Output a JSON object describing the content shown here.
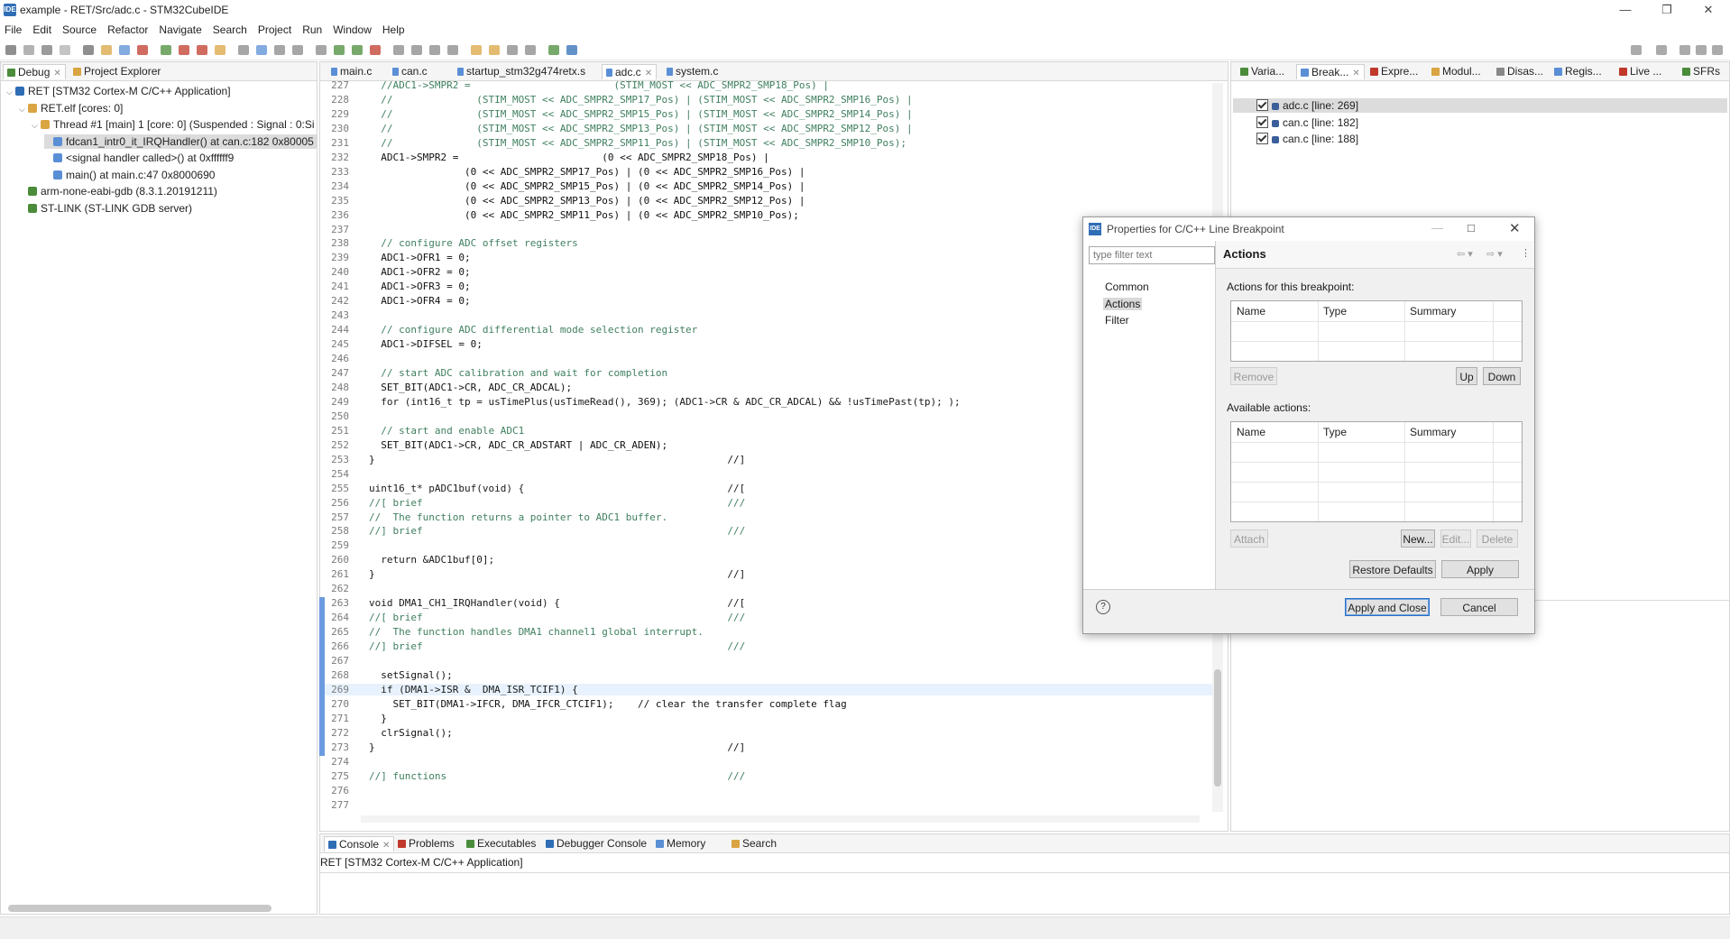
{
  "window": {
    "title": "example - RET/Src/adc.c - STM32CubeIDE",
    "app_icon": "IDE"
  },
  "menu": [
    "File",
    "Edit",
    "Source",
    "Refactor",
    "Navigate",
    "Search",
    "Project",
    "Run",
    "Window",
    "Help"
  ],
  "left_panel": {
    "tabs": [
      {
        "label": "Debug",
        "icon": "debug-icon"
      },
      {
        "label": "Project Explorer",
        "icon": "project-explorer-icon"
      }
    ],
    "tree": [
      {
        "label": "RET [STM32 Cortex-M C/C++ Application]",
        "indent": 0,
        "icon": "ide-launch-icon"
      },
      {
        "label": "RET.elf [cores: 0]",
        "indent": 1,
        "icon": "elf-icon"
      },
      {
        "label": "Thread #1 [main] 1 [core: 0] (Suspended : Signal : 0:Si",
        "indent": 2,
        "icon": "thread-icon"
      },
      {
        "label": "fdcan1_intr0_it_IRQHandler() at can.c:182 0x80005",
        "indent": 3,
        "icon": "stack-frame-icon",
        "selected": true
      },
      {
        "label": "<signal handler called>() at 0xffffff9",
        "indent": 3,
        "icon": "stack-frame-icon"
      },
      {
        "label": "main() at main.c:47 0x8000690",
        "indent": 3,
        "icon": "stack-frame-icon"
      },
      {
        "label": "arm-none-eabi-gdb (8.3.1.20191211)",
        "indent": 1,
        "icon": "gdb-icon"
      },
      {
        "label": "ST-LINK (ST-LINK GDB server)",
        "indent": 1,
        "icon": "stlink-icon"
      }
    ]
  },
  "editor": {
    "tabs": [
      "main.c",
      "can.c",
      "startup_stm32g474retx.s",
      "adc.c",
      "system.c"
    ],
    "active_tab": "adc.c",
    "lines": [
      {
        "n": "227",
        "t": "  //ADC1->SMPR2 =                        (STIM_MOST << ADC_SMPR2_SMP18_Pos) |"
      },
      {
        "n": "228",
        "t": "  //              (STIM_MOST << ADC_SMPR2_SMP17_Pos) | (STIM_MOST << ADC_SMPR2_SMP16_Pos) |"
      },
      {
        "n": "229",
        "t": "  //              (STIM_MOST << ADC_SMPR2_SMP15_Pos) | (STIM_MOST << ADC_SMPR2_SMP14_Pos) |"
      },
      {
        "n": "230",
        "t": "  //              (STIM_MOST << ADC_SMPR2_SMP13_Pos) | (STIM_MOST << ADC_SMPR2_SMP12_Pos) |"
      },
      {
        "n": "231",
        "t": "  //              (STIM_MOST << ADC_SMPR2_SMP11_Pos) | (STIM_MOST << ADC_SMPR2_SMP10_Pos);"
      },
      {
        "n": "232",
        "t": "  ADC1->SMPR2 =                        (0 << ADC_SMPR2_SMP18_Pos) |"
      },
      {
        "n": "233",
        "t": "                (0 << ADC_SMPR2_SMP17_Pos) | (0 << ADC_SMPR2_SMP16_Pos) |"
      },
      {
        "n": "234",
        "t": "                (0 << ADC_SMPR2_SMP15_Pos) | (0 << ADC_SMPR2_SMP14_Pos) |"
      },
      {
        "n": "235",
        "t": "                (0 << ADC_SMPR2_SMP13_Pos) | (0 << ADC_SMPR2_SMP12_Pos) |"
      },
      {
        "n": "236",
        "t": "                (0 << ADC_SMPR2_SMP11_Pos) | (0 << ADC_SMPR2_SMP10_Pos);"
      },
      {
        "n": "237",
        "t": ""
      },
      {
        "n": "238",
        "t": "  // configure ADC offset registers"
      },
      {
        "n": "239",
        "t": "  ADC1->OFR1 = 0;"
      },
      {
        "n": "240",
        "t": "  ADC1->OFR2 = 0;"
      },
      {
        "n": "241",
        "t": "  ADC1->OFR3 = 0;"
      },
      {
        "n": "242",
        "t": "  ADC1->OFR4 = 0;"
      },
      {
        "n": "243",
        "t": ""
      },
      {
        "n": "244",
        "t": "  // configure ADC differential mode selection register"
      },
      {
        "n": "245",
        "t": "  ADC1->DIFSEL = 0;"
      },
      {
        "n": "246",
        "t": ""
      },
      {
        "n": "247",
        "t": "  // start ADC calibration and wait for completion"
      },
      {
        "n": "248",
        "t": "  SET_BIT(ADC1->CR, ADC_CR_ADCAL);"
      },
      {
        "n": "249",
        "t": "  for (int16_t tp = usTimePlus(usTimeRead(), 369); (ADC1->CR & ADC_CR_ADCAL) && !usTimePast(tp); );"
      },
      {
        "n": "250",
        "t": ""
      },
      {
        "n": "251",
        "t": "  // start and enable ADC1"
      },
      {
        "n": "252",
        "t": "  SET_BIT(ADC1->CR, ADC_CR_ADSTART | ADC_CR_ADEN);"
      },
      {
        "n": "253",
        "t": "}                                                           //]"
      },
      {
        "n": "254",
        "t": ""
      },
      {
        "n": "255",
        "t": "uint16_t* pADC1buf(void) {                                  //["
      },
      {
        "n": "256",
        "t": "//[ brief                                                   ///"
      },
      {
        "n": "257",
        "t": "//  The function returns a pointer to ADC1 buffer."
      },
      {
        "n": "258",
        "t": "//] brief                                                   ///"
      },
      {
        "n": "259",
        "t": ""
      },
      {
        "n": "260",
        "t": "  return &ADC1buf[0];"
      },
      {
        "n": "261",
        "t": "}                                                           //]"
      },
      {
        "n": "262",
        "t": ""
      },
      {
        "n": "263",
        "t": "void DMA1_CH1_IRQHandler(void) {                            //["
      },
      {
        "n": "264",
        "t": "//[ brief                                                   ///"
      },
      {
        "n": "265",
        "t": "//  The function handles DMA1 channel1 global interrupt."
      },
      {
        "n": "266",
        "t": "//] brief                                                   ///"
      },
      {
        "n": "267",
        "t": ""
      },
      {
        "n": "268",
        "t": "  setSignal();"
      },
      {
        "n": "269",
        "t": "  if (DMA1->ISR &  DMA_ISR_TCIF1) {"
      },
      {
        "n": "270",
        "t": "    SET_BIT(DMA1->IFCR, DMA_IFCR_CTCIF1);    // clear the transfer complete flag"
      },
      {
        "n": "271",
        "t": "  }"
      },
      {
        "n": "272",
        "t": "  clrSignal();"
      },
      {
        "n": "273",
        "t": "}                                                           //]"
      },
      {
        "n": "274",
        "t": ""
      },
      {
        "n": "275",
        "t": "//] functions                                               ///"
      },
      {
        "n": "276",
        "t": ""
      },
      {
        "n": "277",
        "t": ""
      }
    ]
  },
  "right_panel": {
    "tabs": [
      "Varia...",
      "Break...",
      "Expre...",
      "Modul...",
      "Disas...",
      "Regis...",
      "Live ...",
      "SFRs"
    ],
    "breakpoints": [
      {
        "label": "adc.c [line: 269]",
        "checked": true,
        "selected": true
      },
      {
        "label": "can.c [line: 182]",
        "checked": true
      },
      {
        "label": "can.c [line: 188]",
        "checked": true
      }
    ]
  },
  "bottom_panel": {
    "tabs": [
      "Console",
      "Problems",
      "Executables",
      "Debugger Console",
      "Memory",
      "Search"
    ],
    "console_title": "RET [STM32 Cortex-M C/C++ Application]"
  },
  "dialog": {
    "title": "Properties for C/C++ Line Breakpoint",
    "icon": "IDE",
    "filter_placeholder": "type filter text",
    "nav": [
      "Common",
      "Actions",
      "Filter"
    ],
    "selected_nav": "Actions",
    "page_title": "Actions",
    "section1": "Actions for this breakpoint:",
    "section2": "Available actions:",
    "columns": [
      "Name",
      "Type",
      "Summary"
    ],
    "buttons": {
      "remove": "Remove",
      "up": "Up",
      "down": "Down",
      "attach": "Attach",
      "new": "New...",
      "edit": "Edit...",
      "delete": "Delete",
      "restore": "Restore Defaults",
      "apply": "Apply",
      "apply_close": "Apply and Close",
      "cancel": "Cancel"
    },
    "help": "?"
  },
  "colors": {
    "accent": "#2f6db5",
    "selection": "#cde3f7",
    "comment": "#3f7f5f",
    "keyword": "#7f0055",
    "field": "#0000c0"
  }
}
